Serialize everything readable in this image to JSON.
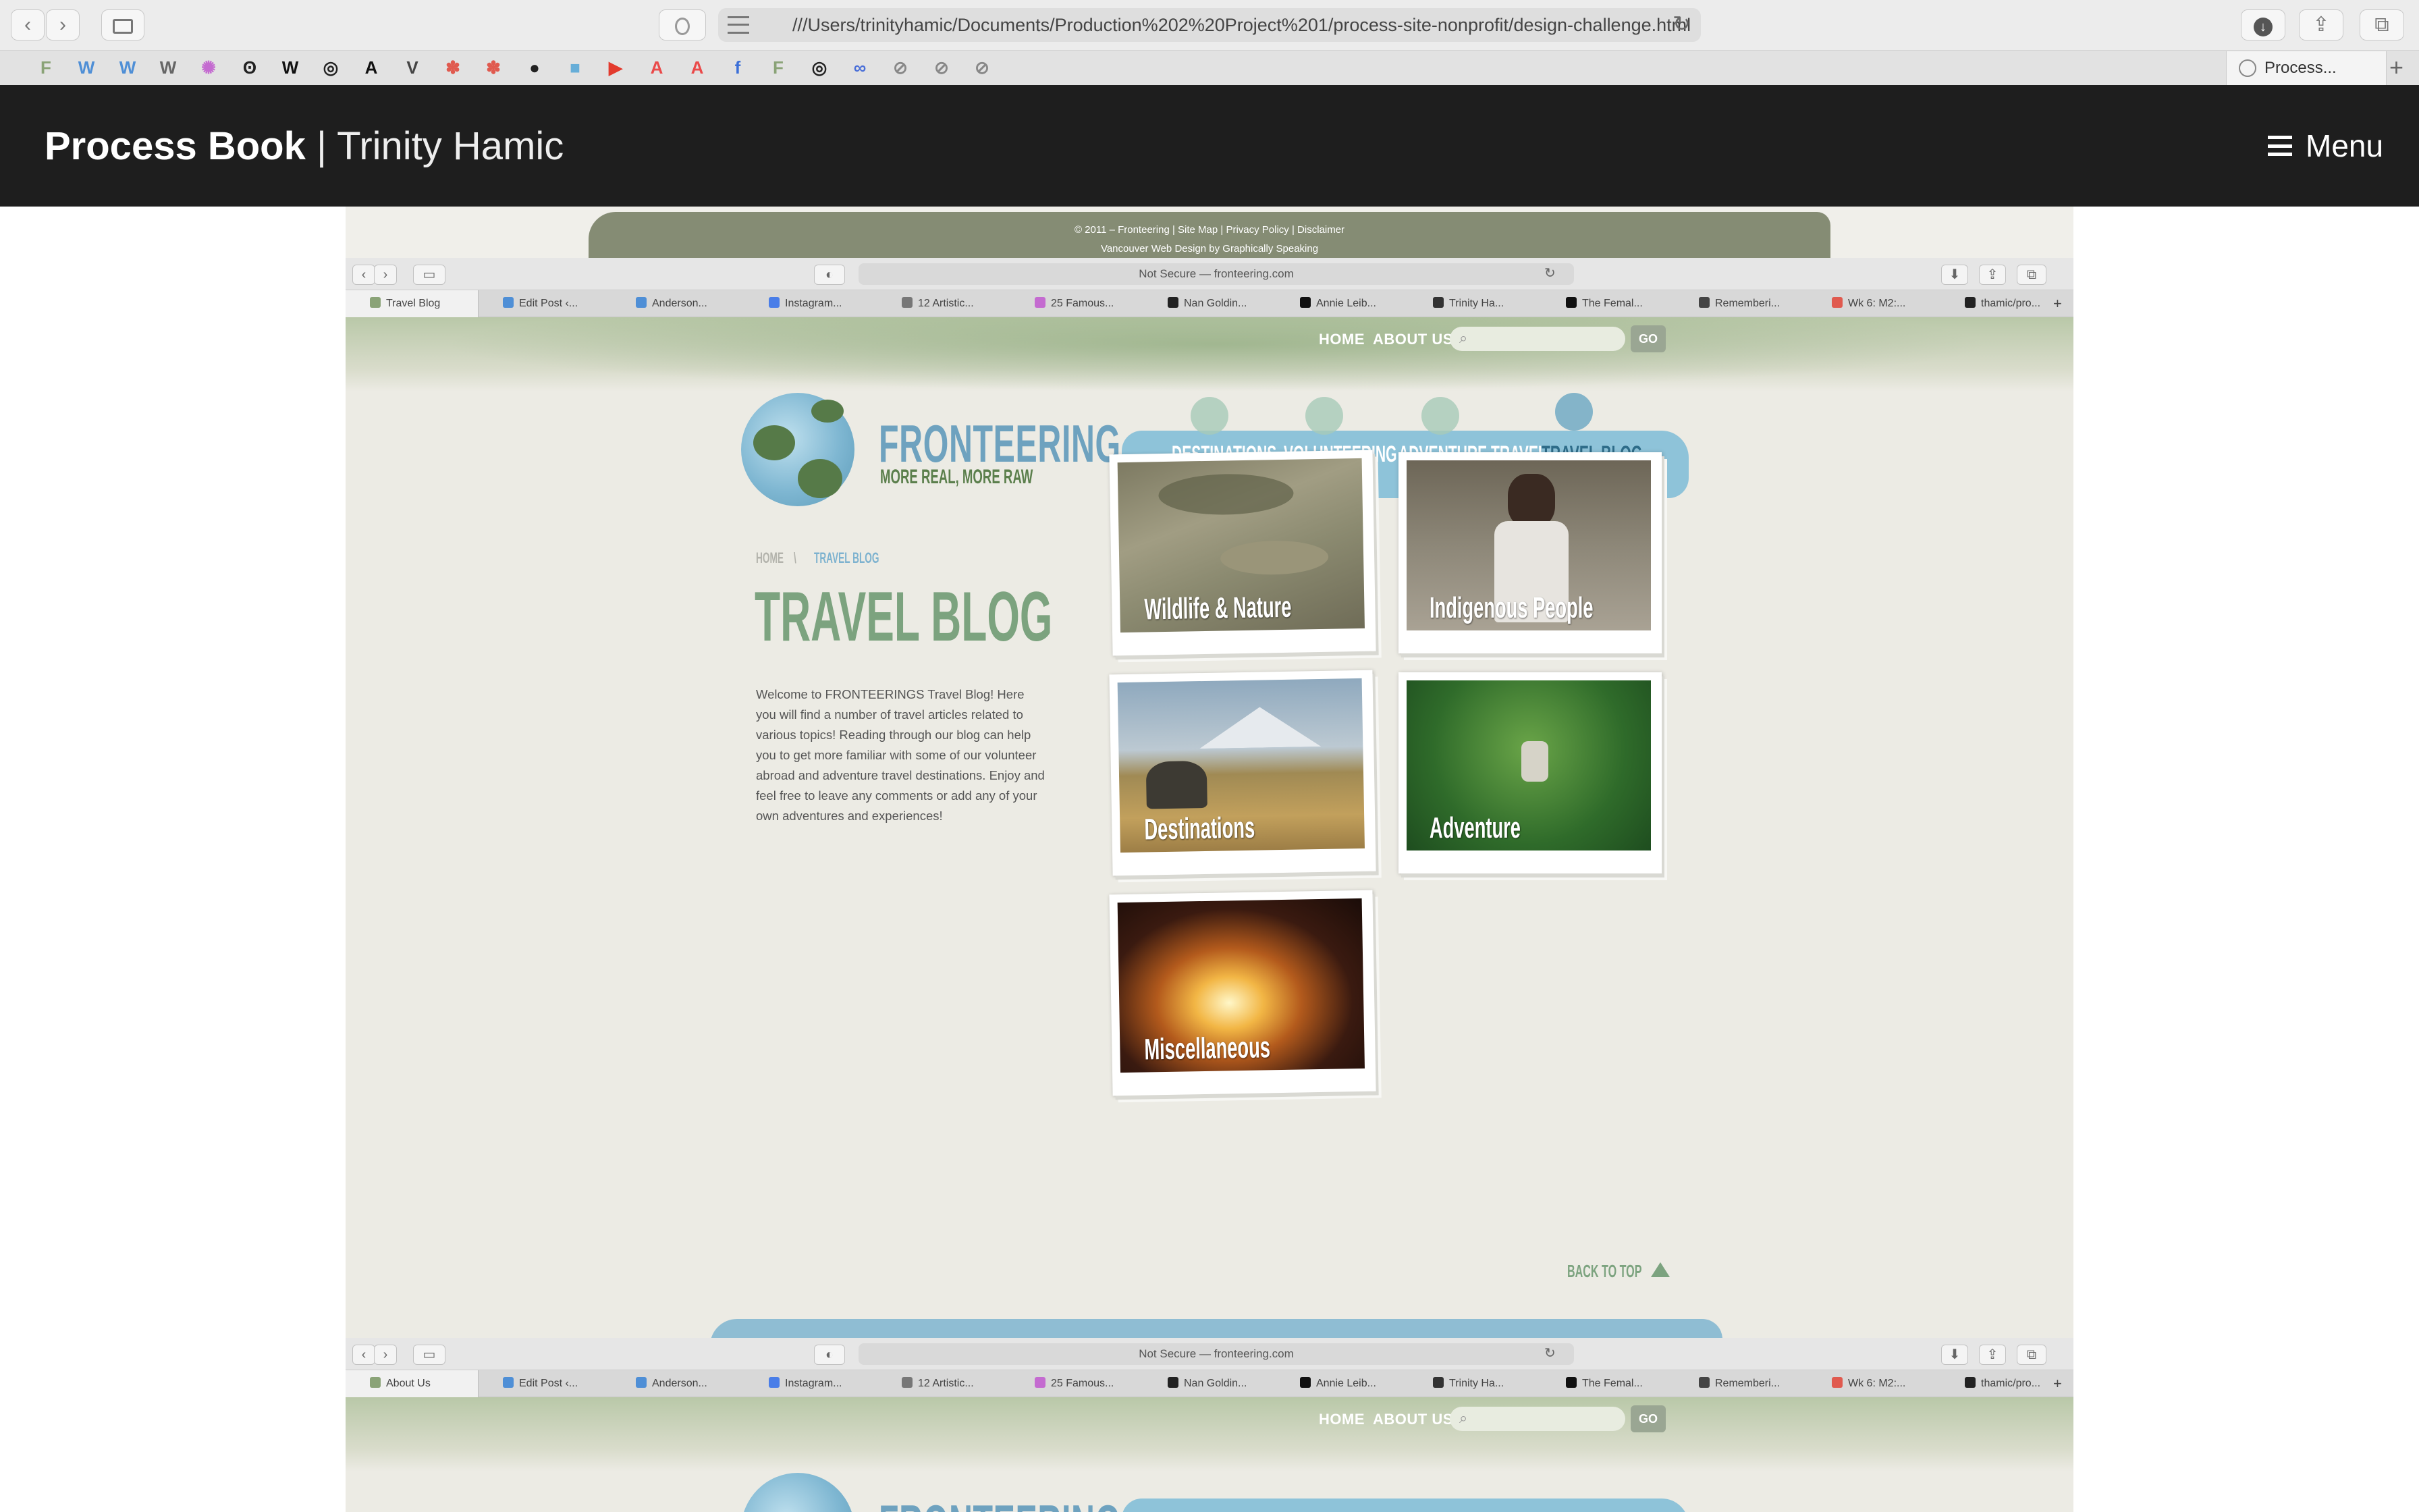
{
  "browser": {
    "url": "///Users/trinityhamic/Documents/Production%202%20Project%201/process-site-nonprofit/design-challenge.html",
    "active_tab": "Process...",
    "favorites": [
      {
        "icon": "fronteering-icon",
        "glyph": "F",
        "color": "#8aa377"
      },
      {
        "icon": "wordpress-icon",
        "glyph": "W",
        "color": "#4f8fd6"
      },
      {
        "icon": "wordpress-icon",
        "glyph": "W",
        "color": "#4f8fd6"
      },
      {
        "icon": "wikipedia-icon",
        "glyph": "W",
        "color": "#666666"
      },
      {
        "icon": "colorwheel-icon",
        "glyph": "✺",
        "color": "#c46bd0"
      },
      {
        "icon": "nangoldin-icon",
        "glyph": "ʘ",
        "color": "#222222"
      },
      {
        "icon": "wikipedia-icon",
        "glyph": "W",
        "color": "#111111"
      },
      {
        "icon": "instagram-icon",
        "glyph": "◎",
        "color": "#222222"
      },
      {
        "icon": "feminist-icon",
        "glyph": "A",
        "color": "#111111"
      },
      {
        "icon": "verge-icon",
        "glyph": "V",
        "color": "#444444"
      },
      {
        "icon": "asterisk-icon",
        "glyph": "✽",
        "color": "#e05a4f"
      },
      {
        "icon": "asterisk-icon",
        "glyph": "✽",
        "color": "#e05a4f"
      },
      {
        "icon": "github-icon",
        "glyph": "●",
        "color": "#222222"
      },
      {
        "icon": "blue-square-icon",
        "glyph": "■",
        "color": "#67aed8"
      },
      {
        "icon": "youtube-icon",
        "glyph": "▶",
        "color": "#e33b2e"
      },
      {
        "icon": "adobe-icon",
        "glyph": "A",
        "color": "#ea4a4a"
      },
      {
        "icon": "adobe-icon",
        "glyph": "A",
        "color": "#ea4a4a"
      },
      {
        "icon": "facebook-icon",
        "glyph": "f",
        "color": "#3b6fd8"
      },
      {
        "icon": "fronteering-icon",
        "glyph": "F",
        "color": "#8aa377"
      },
      {
        "icon": "instagram-icon",
        "glyph": "◎",
        "color": "#222222"
      },
      {
        "icon": "link-icon",
        "glyph": "∞",
        "color": "#4a6fd8"
      },
      {
        "icon": "compass-icon",
        "glyph": "⊘",
        "color": "#888888"
      },
      {
        "icon": "compass-icon",
        "glyph": "⊘",
        "color": "#888888"
      },
      {
        "icon": "compass-icon",
        "glyph": "⊘",
        "color": "#888888"
      }
    ]
  },
  "site": {
    "title_strong": "Process Book",
    "title_separator": " | ",
    "title_light": "Trinity Hamic",
    "menu_label": "Menu"
  },
  "embedded": {
    "footer_line1": "© 2011 – Fronteering | Site Map | Privacy Policy | Disclaimer",
    "footer_line2": "Vancouver Web Design by Graphically Speaking",
    "browser": {
      "url": "Not Secure — fronteering.com",
      "tabs_1": [
        {
          "label": "Travel Blog",
          "color": "#8aa377",
          "active": true
        },
        {
          "label": "Edit Post ‹...",
          "color": "#4f8fd6"
        },
        {
          "label": "Anderson...",
          "color": "#4f8fd6"
        },
        {
          "label": "Instagram...",
          "color": "#4a7ee8"
        },
        {
          "label": "12 Artistic...",
          "color": "#777777"
        },
        {
          "label": "25 Famous...",
          "color": "#c46bd0"
        },
        {
          "label": "Nan Goldin...",
          "color": "#222222"
        },
        {
          "label": "Annie Leib...",
          "color": "#111111"
        },
        {
          "label": "Trinity Ha...",
          "color": "#333333"
        },
        {
          "label": "The Femal...",
          "color": "#111111"
        },
        {
          "label": "Rememberi...",
          "color": "#444444"
        },
        {
          "label": "Wk 6: M2:...",
          "color": "#e05a4f"
        },
        {
          "label": "thamic/pro...",
          "color": "#222222"
        }
      ],
      "tabs_2": [
        {
          "label": "About Us",
          "color": "#8aa377",
          "active": true
        },
        {
          "label": "Edit Post ‹...",
          "color": "#4f8fd6"
        },
        {
          "label": "Anderson...",
          "color": "#4f8fd6"
        },
        {
          "label": "Instagram...",
          "color": "#4a7ee8"
        },
        {
          "label": "12 Artistic...",
          "color": "#777777"
        },
        {
          "label": "25 Famous...",
          "color": "#c46bd0"
        },
        {
          "label": "Nan Goldin...",
          "color": "#222222"
        },
        {
          "label": "Annie Leib...",
          "color": "#111111"
        },
        {
          "label": "Trinity Ha...",
          "color": "#333333"
        },
        {
          "label": "The Femal...",
          "color": "#111111"
        },
        {
          "label": "Rememberi...",
          "color": "#444444"
        },
        {
          "label": "Wk 6: M2:...",
          "color": "#e05a4f"
        },
        {
          "label": "thamic/pro...",
          "color": "#222222"
        }
      ]
    },
    "site": {
      "top_nav": [
        "HOME",
        "ABOUT US"
      ],
      "search_button": "GO",
      "logo_word": "FRONTEERING",
      "logo_tagline": "MORE REAL, MORE RAW",
      "main_nav": [
        "DESTINATIONS",
        "VOLUNTEERING",
        "ADVENTURE TRAVEL",
        "TRAVEL BLOG"
      ],
      "breadcrumb_home": "HOME",
      "breadcrumb_sep": "\\",
      "breadcrumb_current": "TRAVEL BLOG",
      "page_title": "TRAVEL BLOG",
      "intro": "Welcome to FRONTEERINGS Travel Blog! Here you will find a number of travel articles related to various topics! Reading through our blog can help you to get more familiar with some of our volunteer abroad and adventure travel destinations. Enjoy and feel free to leave any comments or add any of your own adventures and experiences!",
      "cards": [
        "Wildlife & Nature",
        "Indigenous People",
        "Destinations",
        "Adventure",
        "Miscellaneous"
      ],
      "back_to_top": "BACK TO TOP"
    }
  }
}
